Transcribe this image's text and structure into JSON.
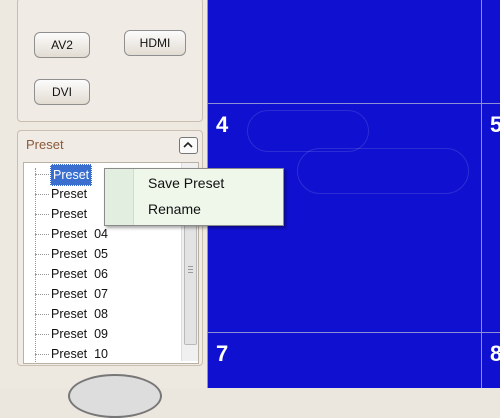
{
  "sources": {
    "av2": "AV2",
    "hdmi": "HDMI",
    "dvi": "DVI"
  },
  "preset_panel": {
    "title": "Preset",
    "items": [
      "Preset",
      "Preset",
      "Preset",
      "Preset  04",
      "Preset  05",
      "Preset  06",
      "Preset  07",
      "Preset  08",
      "Preset  09",
      "Preset  10"
    ]
  },
  "context_menu": {
    "save": "Save Preset",
    "rename": "Rename"
  },
  "grid": {
    "cells": [
      "4",
      "5",
      "7",
      "8"
    ],
    "background": "#1010d0"
  }
}
